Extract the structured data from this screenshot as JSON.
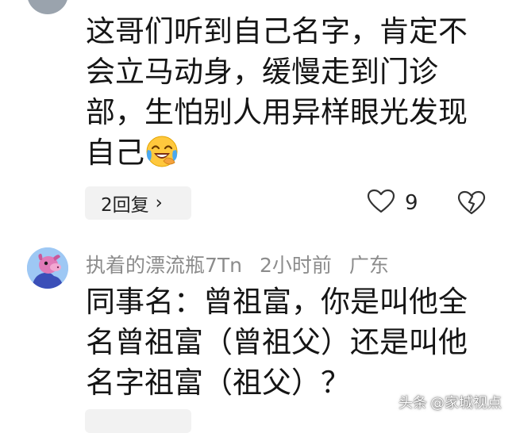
{
  "comment1": {
    "lines": [
      "这哥们听到自己名字，肯定不",
      "会立马动身，缓慢走到门诊",
      "部，生怕别人用异样眼光发现",
      "自己"
    ],
    "emoji": "laughing-crying-emoji",
    "reply_label": "2回复",
    "reply_chevron": "›",
    "like_count": "9"
  },
  "comment2": {
    "username": "执着的漂流瓶7Tn",
    "time": "2小时前",
    "location": "广东",
    "lines": [
      "同事名：曾祖富，你是叫他全",
      "名曾祖富（曾祖父）还是叫他",
      "名字祖富（祖父）？"
    ]
  },
  "watermark": {
    "platform": "头条",
    "author": "@家城视点"
  },
  "colors": {
    "meta_gray": "#8c8c8c",
    "reply_bg": "#f2f2f2",
    "avatar_blue": "#9ec8f4"
  }
}
